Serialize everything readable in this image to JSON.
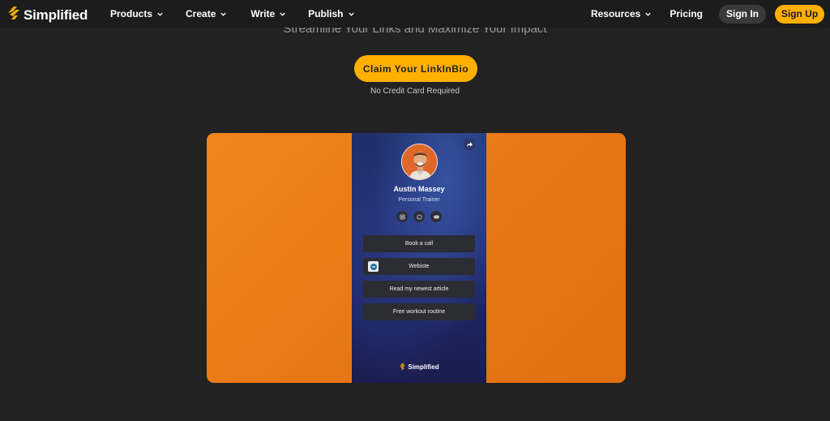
{
  "brand": {
    "name": "Simplified",
    "accent": "#ffb000",
    "icon": "lightning-logo-icon"
  },
  "nav": {
    "items": [
      {
        "label": "Products"
      },
      {
        "label": "Create"
      },
      {
        "label": "Write"
      },
      {
        "label": "Publish"
      }
    ],
    "resources_label": "Resources",
    "pricing_label": "Pricing",
    "signin_label": "Sign In",
    "signup_label": "Sign Up"
  },
  "hero": {
    "tagline": "Streamline Your Links and Maximize Your Impact",
    "cta_label": "Claim Your LinkInBio",
    "cta_note": "No Credit Card Required"
  },
  "preview": {
    "background": "#f0861c",
    "profile": {
      "name": "Austin Massey",
      "role": "Personal Trainer"
    },
    "socials": [
      "instagram-icon",
      "whatsapp-icon",
      "youtube-icon"
    ],
    "links": [
      {
        "label": "Book a call"
      },
      {
        "label": "Webiste"
      },
      {
        "label": "Read my newest article"
      },
      {
        "label": "Free workout routine"
      }
    ],
    "footer_brand": "Simplified"
  }
}
